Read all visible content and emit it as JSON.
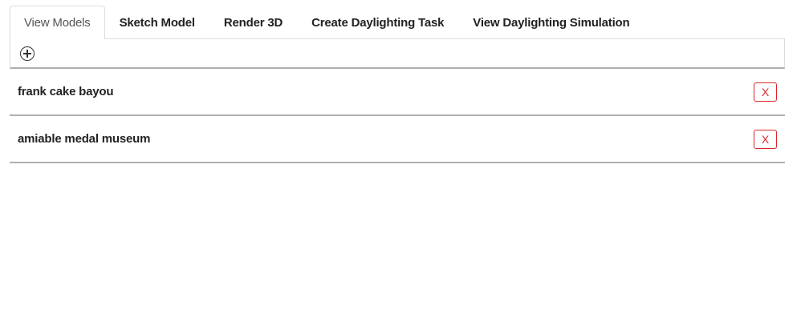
{
  "tabs": [
    {
      "label": "View Models",
      "active": true
    },
    {
      "label": "Sketch Model",
      "active": false
    },
    {
      "label": "Render 3D",
      "active": false
    },
    {
      "label": "Create Daylighting Task",
      "active": false
    },
    {
      "label": "View Daylighting Simulation",
      "active": false
    }
  ],
  "toolbar": {
    "add_icon": "plus-circle-icon"
  },
  "models": [
    {
      "name": "frank cake bayou",
      "delete_label": "X"
    },
    {
      "name": "amiable medal museum",
      "delete_label": "X"
    }
  ],
  "colors": {
    "delete_accent": "#d9262b",
    "divider": "#b0b0b0",
    "tab_border": "#dcdcdc"
  }
}
